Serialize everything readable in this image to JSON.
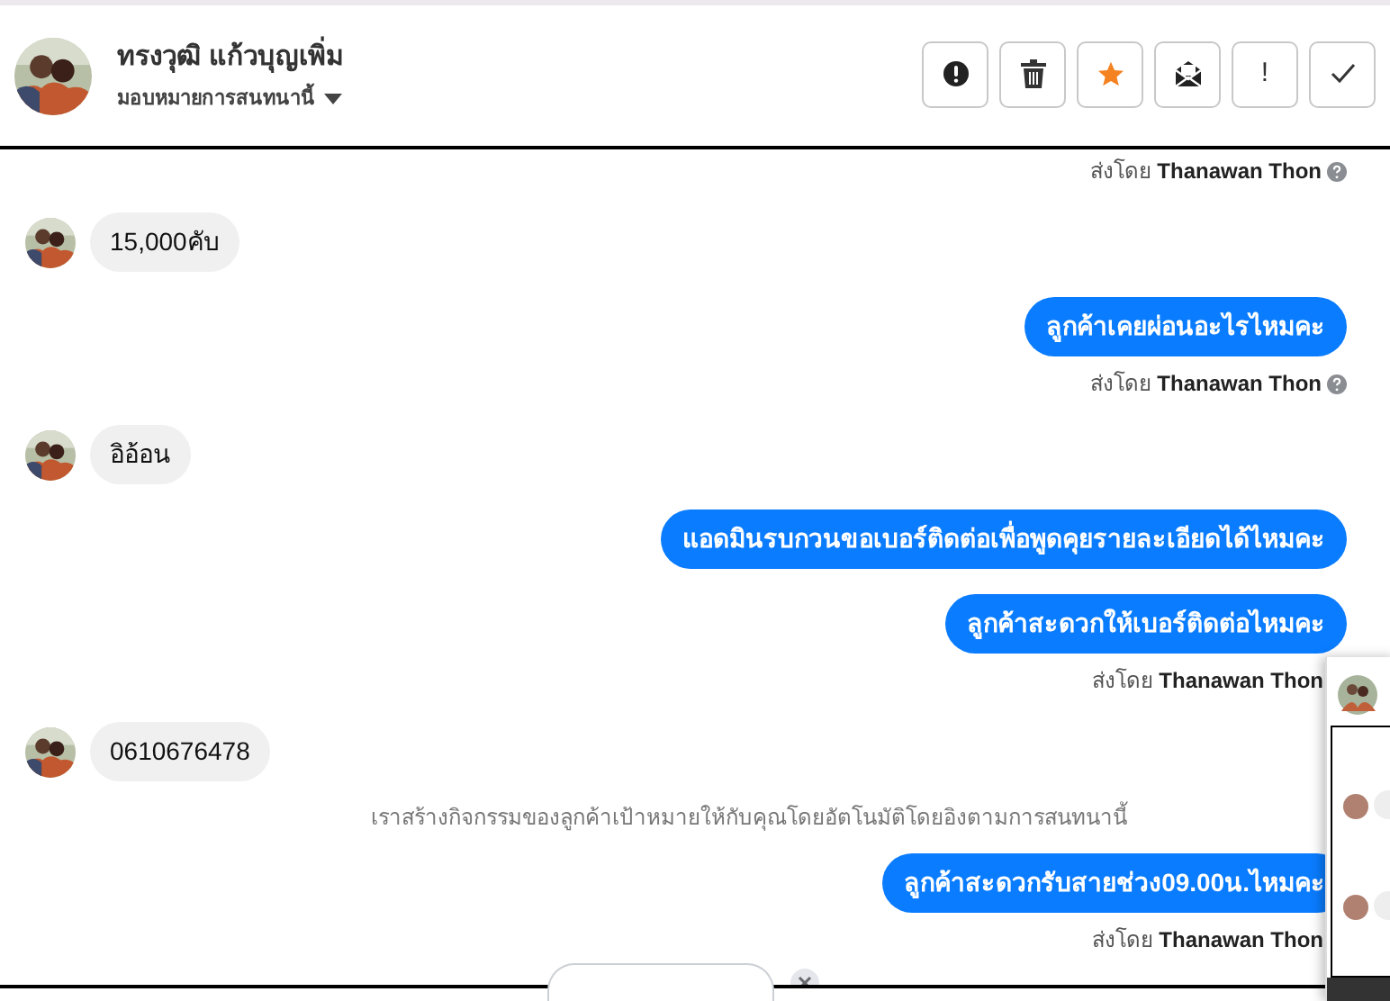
{
  "header": {
    "name": "ทรงวุฒิ แก้วบุญเพิ่ม",
    "assign_label": "มอบหมายการสนทนานี้",
    "actions": [
      {
        "kind": "alert"
      },
      {
        "kind": "trash"
      },
      {
        "kind": "star"
      },
      {
        "kind": "mail"
      },
      {
        "kind": "text",
        "label": "!"
      },
      {
        "kind": "check"
      }
    ]
  },
  "messages": [
    {
      "kind": "sent_by",
      "prefix": "ส่งโดย",
      "sender": "Thanawan Thon",
      "help_icon": true
    },
    {
      "kind": "incoming",
      "text": "15,000คับ"
    },
    {
      "kind": "outgoing",
      "text": "ลูกค้าเคยผ่อนอะไรไหมคะ"
    },
    {
      "kind": "sent_by",
      "prefix": "ส่งโดย",
      "sender": "Thanawan Thon",
      "help_icon": true
    },
    {
      "kind": "incoming",
      "text": "อิอ้อน"
    },
    {
      "kind": "outgoing",
      "text": "แอดมินรบกวนขอเบอร์ติดต่อเพื่อพูดคุยรายละเอียดได้ไหมคะ"
    },
    {
      "kind": "outgoing",
      "text": "ลูกค้าสะดวกให้เบอร์ติดต่อไหมคะ"
    },
    {
      "kind": "sent_by",
      "prefix": "ส่งโดย",
      "sender": "Thanawan Thon",
      "help_icon": false
    },
    {
      "kind": "incoming",
      "text": "0610676478"
    },
    {
      "kind": "system",
      "text": "เราสร้างกิจกรรมของลูกค้าเป้าหมายให้กับคุณโดยอัตโนมัติโดยอิงตามการสนทนานี้"
    },
    {
      "kind": "outgoing",
      "text": "ลูกค้าสะดวกรับสายช่วง09.00น.ไหมคะ"
    },
    {
      "kind": "sent_by",
      "prefix": "ส่งโดย",
      "sender": "Thanawan Thon",
      "help_icon": false
    }
  ]
}
